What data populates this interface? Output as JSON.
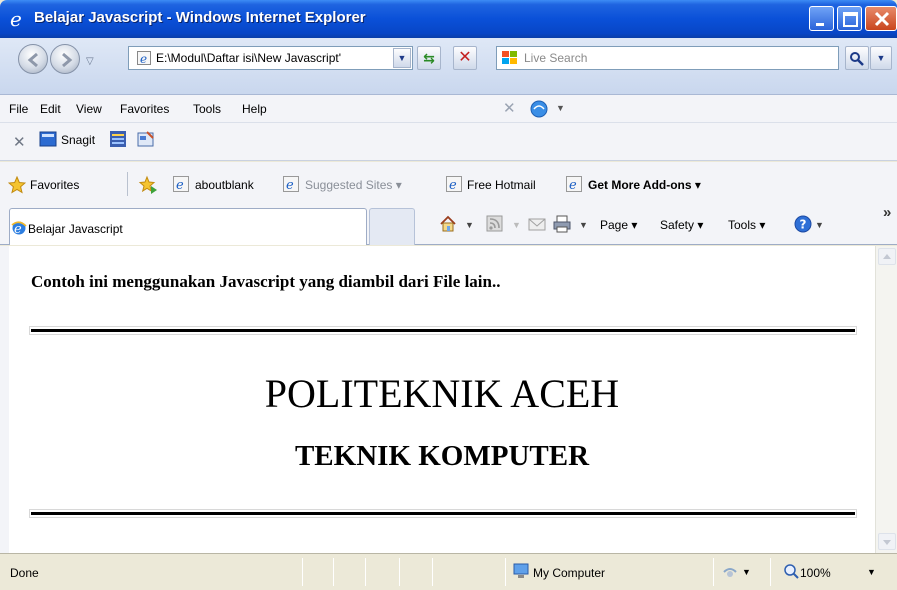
{
  "window": {
    "title": "Belajar Javascript - Windows Internet Explorer"
  },
  "address_bar": {
    "url": "E:\\Modul\\Daftar isi\\New Javascript'",
    "search_placeholder": "Live Search"
  },
  "menu": {
    "items": [
      "File",
      "Edit",
      "View",
      "Favorites",
      "Tools",
      "Help"
    ]
  },
  "snagit_bar": {
    "label": "Snagit"
  },
  "favorites_bar": {
    "favorites_label": "Favorites",
    "links": [
      "aboutblank",
      "Suggested Sites ▾",
      "Free Hotmail",
      "Get More Add-ons ▾"
    ]
  },
  "tabs": {
    "active_tab": "Belajar Javascript"
  },
  "command_bar": {
    "page": "Page",
    "safety": "Safety",
    "tools": "Tools",
    "more": "»"
  },
  "content": {
    "intro": "Contoh ini menggunakan Javascript yang diambil dari File lain..",
    "heading1": "POLITEKNIK ACEH",
    "heading2": "TEKNIK KOMPUTER"
  },
  "status_bar": {
    "status": "Done",
    "zone": "My Computer",
    "zoom": "100%"
  },
  "colors": {
    "titlebar_blue": "#0a50d8",
    "window_chrome": "#ece9d8",
    "toolbar_bg": "#f3f4f8"
  },
  "icons": [
    "ie-logo-icon",
    "back-icon",
    "forward-icon",
    "refresh-icon",
    "stop-icon",
    "search-icon",
    "favorites-star-icon",
    "add-favorite-icon",
    "home-icon",
    "feeds-icon",
    "mail-icon",
    "print-icon",
    "help-icon",
    "computer-icon",
    "zoom-icon"
  ]
}
